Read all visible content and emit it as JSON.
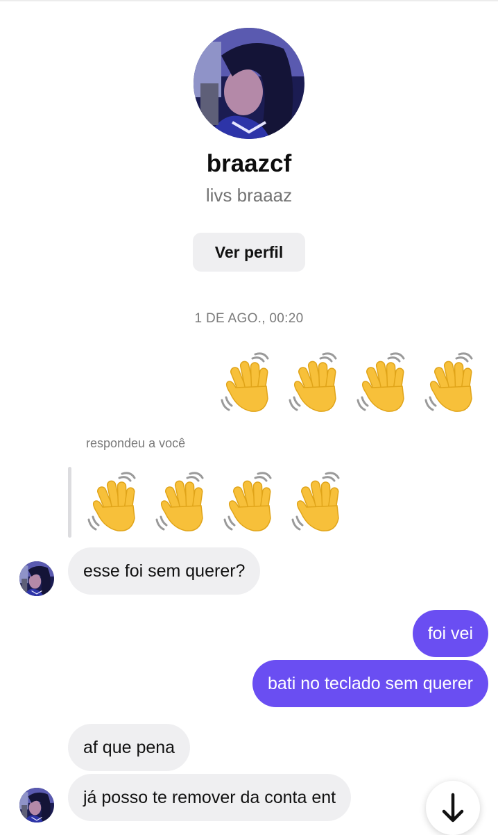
{
  "header": {
    "username": "braazcf",
    "display_name": "livs braaaz",
    "view_profile_label": "Ver perfil"
  },
  "thread": {
    "timestamp": "1 DE AGO., 00:20",
    "reply_label": "respondeu a você",
    "sent_emojis": [
      "👋",
      "👋",
      "👋",
      "👋"
    ],
    "quoted_emojis": [
      "👋",
      "👋",
      "👋",
      "👋"
    ],
    "messages": [
      {
        "from": "them",
        "text": "esse foi sem querer?"
      },
      {
        "from": "me",
        "text": "foi vei"
      },
      {
        "from": "me",
        "text": "bati no teclado sem querer"
      },
      {
        "from": "them",
        "text": "af que pena"
      },
      {
        "from": "them",
        "text": "já posso te remover da conta ent"
      }
    ]
  },
  "colors": {
    "sent_bubble": "#6a4ef2",
    "received_bubble": "#efeff1",
    "muted_text": "#7a7a7a"
  },
  "icons": {
    "wave": "waving-hand-icon",
    "scroll_down": "arrow-down-icon"
  }
}
